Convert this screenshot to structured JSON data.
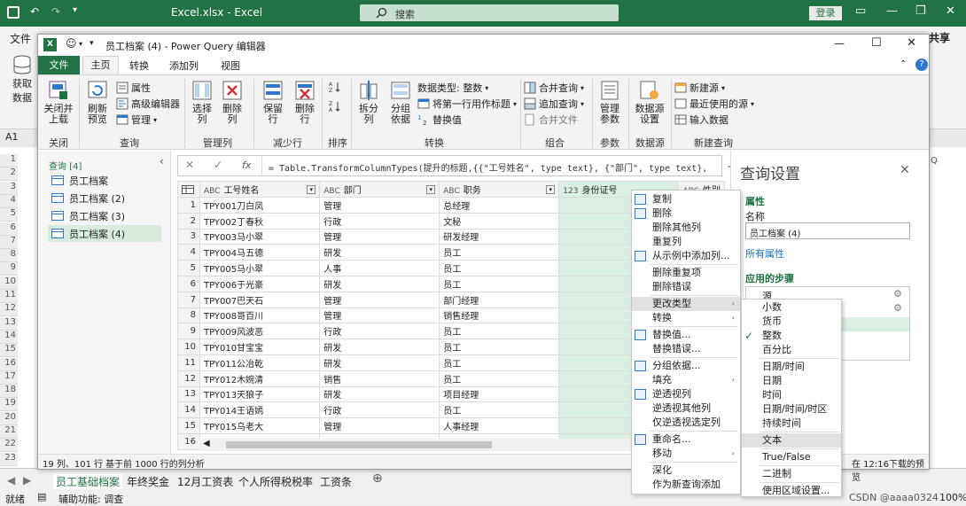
{
  "excel": {
    "title": "Excel.xlsx  -  Excel",
    "search": "搜索",
    "login": "登录",
    "file_tab": "文件",
    "share": "共享",
    "get_data": "获取数据",
    "namebox": "A1",
    "col_q": "Q",
    "rows": [
      "1",
      "2",
      "3",
      "4",
      "5",
      "6",
      "7",
      "8",
      "9",
      "10",
      "11",
      "12",
      "13",
      "14",
      "15",
      "16",
      "17",
      "18",
      "19",
      "20",
      "21",
      "22",
      "23"
    ],
    "sheets": [
      "员工基础档案",
      "年终奖金",
      "12月工资表",
      "个人所得税税率",
      "工资条"
    ],
    "status_ready": "就绪",
    "status_access": "辅助功能: 调查",
    "zoom": "100%",
    "watermark": "CSDN @aaaa0324"
  },
  "pq": {
    "title": "员工档案 (4) - Power Query 编辑器",
    "tabs": [
      "文件",
      "主页",
      "转换",
      "添加列",
      "视图"
    ],
    "ribbon": {
      "close_load": "关闭并\n上载",
      "refresh": "刷新\n预览",
      "properties": "属性",
      "adv_editor": "高级编辑器",
      "manage": "管理",
      "choose_cols": "选择\n列",
      "remove_cols": "删除\n列",
      "keep_rows": "保留\n行",
      "remove_rows": "删除\n行",
      "split_col": "拆分\n列",
      "group_by": "分组\n依据",
      "data_type": "数据类型: 整数",
      "first_row_header": "将第一行用作标题",
      "replace_vals": "替换值",
      "merge_queries": "合并查询",
      "append_queries": "追加查询",
      "combine_files": "合并文件",
      "manage_params": "管理\n参数",
      "ds_settings": "数据源\n设置",
      "new_source": "新建源",
      "recent_sources": "最近使用的源",
      "enter_data": "输入数据",
      "groups": [
        "关闭",
        "查询",
        "管理列",
        "减少行",
        "排序",
        "转换",
        "组合",
        "参数",
        "数据源",
        "新建查询"
      ]
    },
    "queries_header": "查询 [4]",
    "queries": [
      "员工档案",
      "员工档案 (2)",
      "员工档案 (3)",
      "员工档案 (4)"
    ],
    "formula": "= Table.TransformColumnTypes(提升的标题,{{\"工号姓名\", type text}, {\"部门\", type text},",
    "columns": [
      "工号姓名",
      "部门",
      "职务",
      "身份证号",
      "性别"
    ],
    "col_types": [
      "ABC",
      "ABC",
      "ABC",
      "123",
      "ABC"
    ],
    "table": [
      [
        "1",
        "TPY001刀白凤",
        "管理",
        "总经理"
      ],
      [
        "2",
        "TPY002丁春秋",
        "行政",
        "文秘"
      ],
      [
        "3",
        "TPY003马小翠",
        "管理",
        "研发经理"
      ],
      [
        "4",
        "TPY004马五德",
        "研发",
        "员工"
      ],
      [
        "5",
        "TPY005马小翠",
        "人事",
        "员工"
      ],
      [
        "6",
        "TPY006于光豪",
        "研发",
        "员工"
      ],
      [
        "7",
        "TPY007巴天石",
        "管理",
        "部门经理"
      ],
      [
        "8",
        "TPY008哥百川",
        "管理",
        "销售经理"
      ],
      [
        "9",
        "TPY009风波恶",
        "行政",
        "员工"
      ],
      [
        "10",
        "TPY010甘宝宝",
        "研发",
        "员工"
      ],
      [
        "11",
        "TPY011公冶乾",
        "研发",
        "员工"
      ],
      [
        "12",
        "TPY012木婉清",
        "销售",
        "员工"
      ],
      [
        "13",
        "TPY013天狼子",
        "研发",
        "项目经理"
      ],
      [
        "14",
        "TPY014王语嫣",
        "行政",
        "员工"
      ],
      [
        "15",
        "TPY015乌老大",
        "管理",
        "人事经理"
      ],
      [
        "16",
        "",
        "",
        ""
      ]
    ],
    "settings": {
      "title": "查询设置",
      "props": "属性",
      "name_label": "名称",
      "name_value": "员工档案 (4)",
      "all_props": "所有属性",
      "steps_label": "应用的步骤",
      "step1": "源"
    },
    "status_left": "19 列、101 行",
    "status_mid": "基于前 1000 行的列分析",
    "status_right": "在 12:16下载的预览"
  },
  "ctx_menu": [
    {
      "label": "复制",
      "icon": "copy-icon",
      "sep_after": false
    },
    {
      "label": "删除",
      "icon": "delete-icon"
    },
    {
      "label": "删除其他列"
    },
    {
      "label": "重复列"
    },
    {
      "label": "从示例中添加列...",
      "icon": "example-icon",
      "sep_after": true
    },
    {
      "label": "删除重复项"
    },
    {
      "label": "删除错误",
      "sep_after": true
    },
    {
      "label": "更改类型",
      "arrow": true,
      "hover": true
    },
    {
      "label": "转换",
      "arrow": true,
      "sep_after": true
    },
    {
      "label": "替换值...",
      "icon": "replace-icon"
    },
    {
      "label": "替换错误...",
      "sep_after": true
    },
    {
      "label": "分组依据...",
      "icon": "group-icon"
    },
    {
      "label": "填充",
      "arrow": true
    },
    {
      "label": "逆透视列",
      "icon": "unpivot-icon"
    },
    {
      "label": "逆透视其他列"
    },
    {
      "label": "仅逆透视选定列",
      "sep_after": true
    },
    {
      "label": "重命名...",
      "icon": "rename-icon"
    },
    {
      "label": "移动",
      "arrow": true,
      "sep_after": true
    },
    {
      "label": "深化"
    },
    {
      "label": "作为新查询添加"
    }
  ],
  "type_menu": [
    {
      "label": "小数"
    },
    {
      "label": "货币"
    },
    {
      "label": "整数",
      "checked": true
    },
    {
      "label": "百分比",
      "sep_after": true
    },
    {
      "label": "日期/时间"
    },
    {
      "label": "日期"
    },
    {
      "label": "时间"
    },
    {
      "label": "日期/时间/时区"
    },
    {
      "label": "持续时间",
      "sep_after": true
    },
    {
      "label": "文本",
      "hover": true,
      "sep_after": true
    },
    {
      "label": "True/False",
      "sep_after": true
    },
    {
      "label": "二进制",
      "sep_after": true
    },
    {
      "label": "使用区域设置..."
    }
  ],
  "colors": {
    "excel_green": "#217346",
    "pq_highlight": "#d9efe1",
    "menu_hover": "#e0e0e0"
  }
}
